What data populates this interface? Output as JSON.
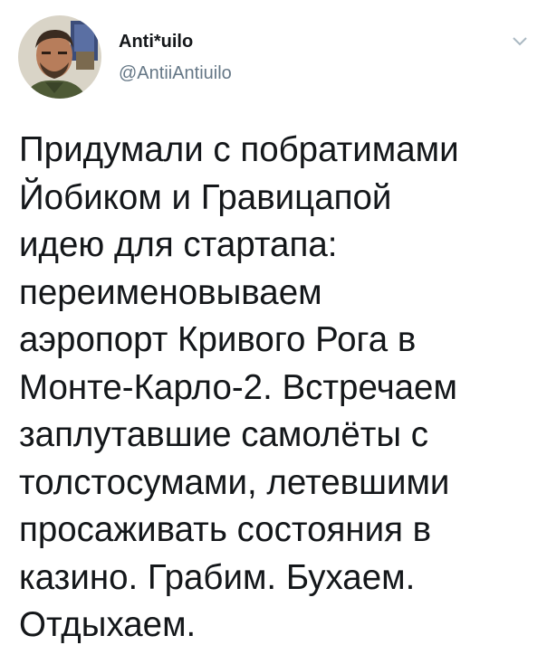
{
  "author": {
    "display_name": "Anti*uilo",
    "handle": "@AntiiAntiuilo",
    "avatar_icon": "profile-photo"
  },
  "menu_icon": "chevron-down-icon",
  "tweet": {
    "lines": [
      "Придумали с побратимами",
      "Йобиком и Гравицапой",
      "идею для стартапа:",
      "переименовываем",
      "аэропорт Кривого Рога в",
      "Монте-Карло-2. Встречаем",
      "заплутавшие самолёты с",
      "толстосумами, летевшими",
      "просаживать состояния в",
      "казино. Грабим. Бухаем.",
      "Отдыхаем."
    ]
  },
  "colors": {
    "text": "#14171a",
    "secondary_text": "#657786",
    "background": "#ffffff",
    "chevron": "#aab8c2"
  }
}
